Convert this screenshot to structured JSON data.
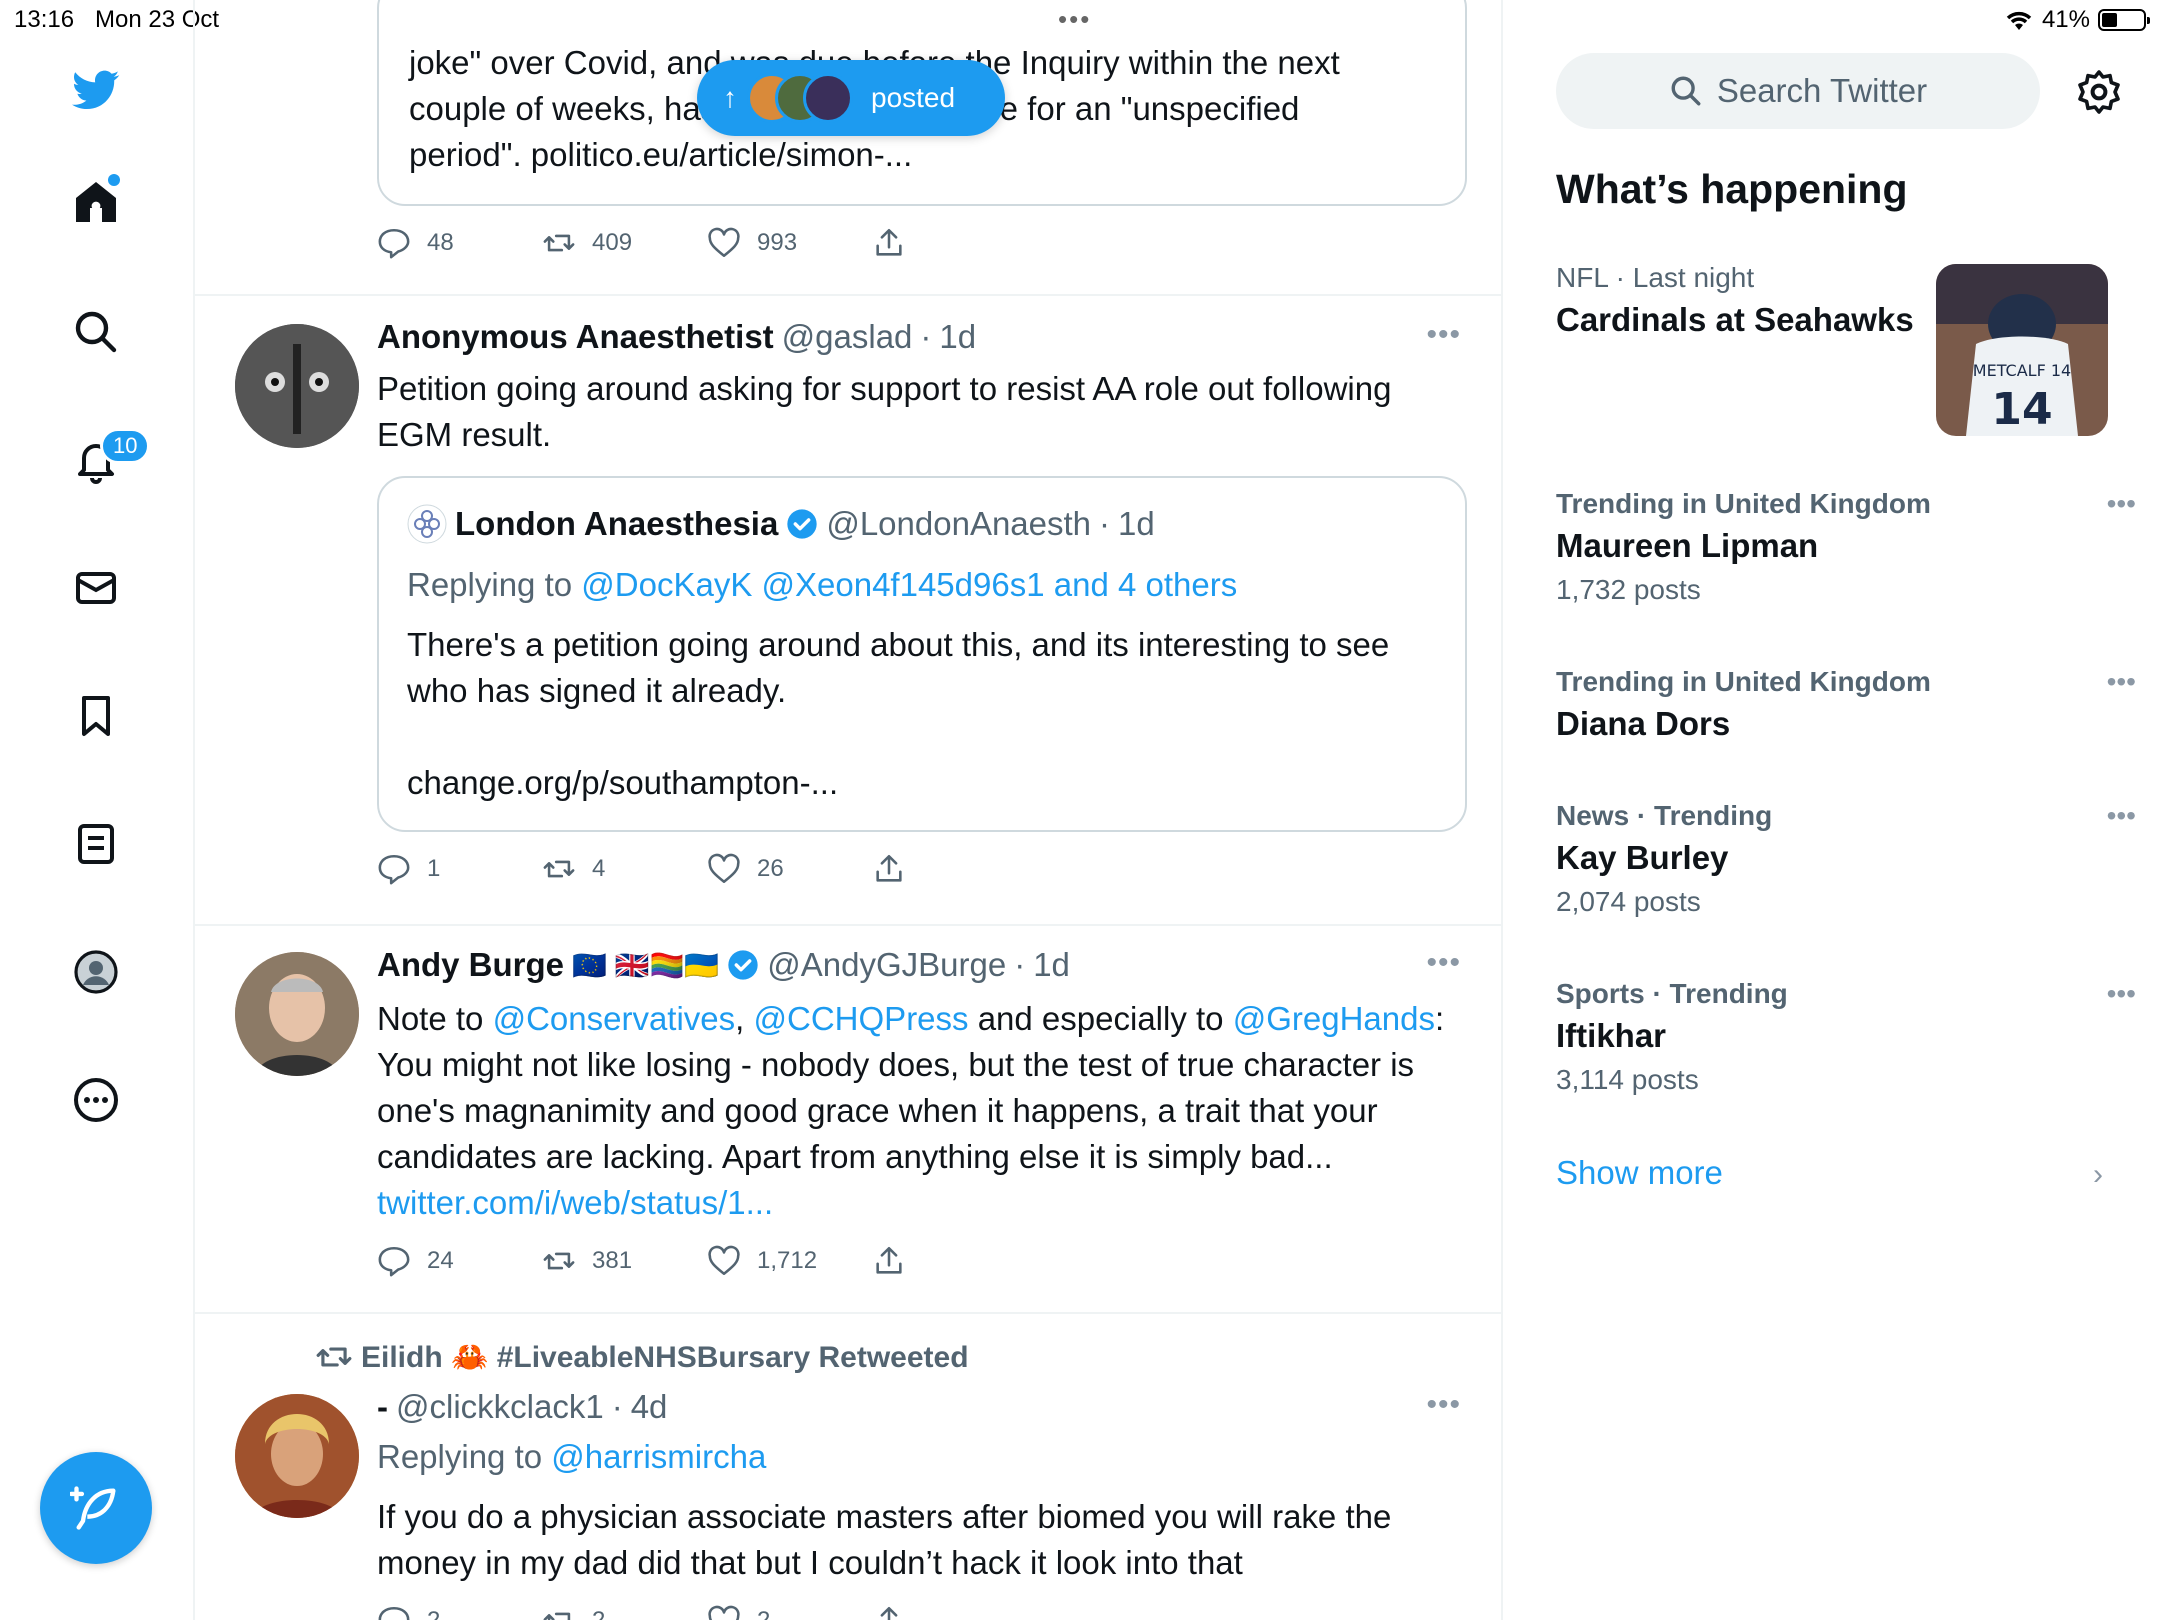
{
  "status": {
    "time": "13:16",
    "date": "Mon 23 Oct",
    "battery": "41%"
  },
  "nav": {
    "notifications_badge": "10"
  },
  "pill": {
    "label": "posted"
  },
  "tweet0": {
    "quote_text_lines": [
      "joke\" over Covid, and was due before the Inquiry within the next",
      "couple of weeks, has taken medical leave for an \"unspecified",
      "period\". politico.eu/article/simon-..."
    ],
    "replies": "48",
    "retweets": "409",
    "likes": "993"
  },
  "tweet1": {
    "name": "Anonymous Anaesthetist",
    "handle": "@gaslad",
    "time": "1d",
    "text": "Petition going around asking for support to resist AA role out following EGM result.",
    "quote": {
      "name": "London Anaesthesia",
      "handle": "@LondonAnaesth",
      "time": "1d",
      "replying_prefix": "Replying to",
      "replying_to": "@DocKayK @Xeon4f145d96s1 and 4 others",
      "text": "There's a petition going around about this, and its interesting to see who has signed it already.",
      "link": "change.org/p/southampton-..."
    },
    "replies": "1",
    "retweets": "4",
    "likes": "26"
  },
  "tweet2": {
    "name": "Andy Burge",
    "flags": "🇪🇺 🇬🇧🏳️‍🌈🇺🇦",
    "handle": "@AndyGJBurge",
    "time": "1d",
    "text_prefix": "Note to",
    "mention1": "@Conservatives",
    "comma": ",",
    "mention2": "@CCHQPress",
    "text_mid": "and especially to",
    "mention3": "@GregHands",
    "text_rest": ": You might not like losing - nobody does, but the test of true character is one's magnanimity and good grace when it happens, a trait that your candidates are lacking.  Apart from anything else it is simply bad...",
    "link": "twitter.com/i/web/status/1...",
    "replies": "24",
    "retweets": "381",
    "likes": "1,712"
  },
  "tweet3": {
    "retweeted_by": "Eilidh 🦀 #LiveableNHSBursary Retweeted",
    "name": "-",
    "handle": "@clickkclack1",
    "time": "4d",
    "replying_prefix": "Replying to",
    "replying_to": "@harrismircha",
    "text": "If you do a physician associate masters after biomed you will rake the money in my dad did that but I couldn’t hack it look into that",
    "replies": "2",
    "retweets": "2",
    "likes": "2"
  },
  "sidebar": {
    "search_placeholder": "Search Twitter",
    "title": "What’s happening",
    "trends": [
      {
        "context": "NFL · Last night",
        "title": "Cardinals at Seahawks",
        "count": ""
      },
      {
        "context": "Trending in United Kingdom",
        "title": "Maureen Lipman",
        "count": "1,732 posts"
      },
      {
        "context": "Trending in United Kingdom",
        "title": "Diana Dors",
        "count": ""
      },
      {
        "context": "News · Trending",
        "title": "Kay Burley",
        "count": "2,074 posts"
      },
      {
        "context": "Sports · Trending",
        "title": "Iftikhar",
        "count": "3,114 posts"
      }
    ],
    "show_more": "Show more",
    "trend_image_caption": "METCALF 14"
  },
  "colors": {
    "accent": "#1d9bf0",
    "text": "#0f1419",
    "muted": "#536471",
    "border": "#eff3f4"
  }
}
